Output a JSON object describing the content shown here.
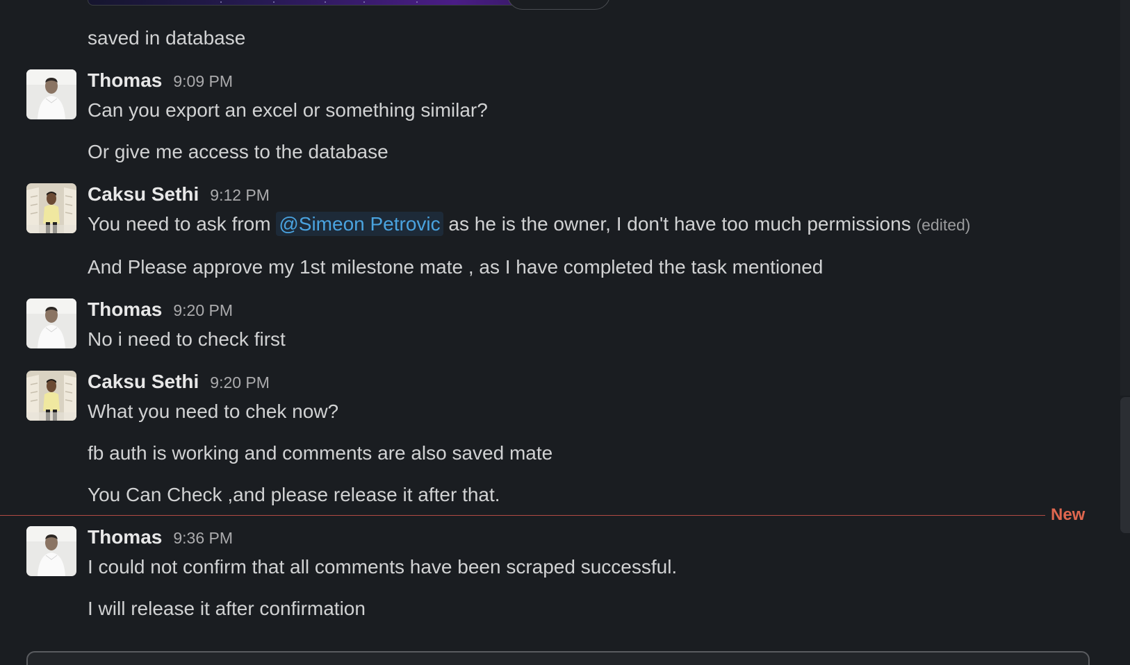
{
  "messages": {
    "m0": {
      "text": "saved in database"
    },
    "m1": {
      "sender": "Thomas",
      "time": "9:09 PM",
      "lines": [
        "Can you export an excel or something similar?",
        "Or give me access to the database"
      ]
    },
    "m2": {
      "sender": "Caksu Sethi",
      "time": "9:12 PM",
      "line1_pre": "You need to ask from ",
      "mention": "@Simeon Petrovic",
      "line1_post": " as he is the owner, I don't have too much permissions ",
      "edited": "(edited)",
      "line2": "And Please approve my 1st milestone mate , as I have completed the task mentioned"
    },
    "m3": {
      "sender": "Thomas",
      "time": "9:20 PM",
      "lines": [
        "No i need to check first"
      ]
    },
    "m4": {
      "sender": "Caksu Sethi",
      "time": "9:20 PM",
      "lines": [
        "What you need to chek now?",
        "fb auth is working and comments are also saved mate",
        "You Can Check ,and please release it after that."
      ]
    },
    "m5": {
      "sender": "Thomas",
      "time": "9:36 PM",
      "lines": [
        "I could not confirm that all comments have been scraped successful.",
        "I will release it after confirmation"
      ]
    }
  },
  "divider": {
    "label": "New"
  },
  "colors": {
    "background": "#1a1d21",
    "text": "#d1d2d3",
    "mention": "#4aa3df",
    "new_divider": "#e0674f"
  },
  "icons": {
    "avatar_thomas": "avatar-thomas",
    "avatar_caksu": "avatar-caksu-sethi"
  }
}
